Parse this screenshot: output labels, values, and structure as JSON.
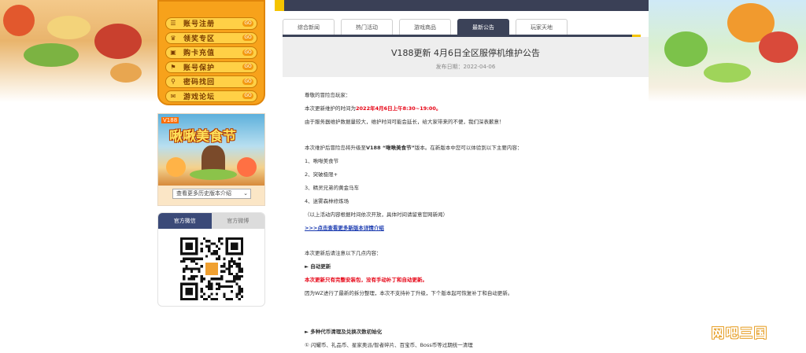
{
  "sidebar": {
    "menu": [
      {
        "label": "账号注册",
        "icon": "list-icon"
      },
      {
        "label": "领奖专区",
        "icon": "trophy-icon"
      },
      {
        "label": "购卡充值",
        "icon": "cart-icon"
      },
      {
        "label": "账号保护",
        "icon": "flag-icon"
      },
      {
        "label": "密码找回",
        "icon": "search-icon"
      },
      {
        "label": "游戏论坛",
        "icon": "chat-icon"
      }
    ],
    "menu_arrow": "GO",
    "promo": {
      "badge": "V188",
      "title": "啾啾美食节",
      "select_value": "查看更多历史版本介绍"
    },
    "qr": {
      "tabs": [
        {
          "label": "官方微信",
          "active": true
        },
        {
          "label": "官方微博",
          "active": false
        }
      ]
    }
  },
  "main": {
    "tabs": [
      {
        "label": "综合新闻",
        "active": false
      },
      {
        "label": "热门活动",
        "active": false
      },
      {
        "label": "游戏商品",
        "active": false
      },
      {
        "label": "最新公告",
        "active": true
      },
      {
        "label": "玩家天地",
        "active": false
      }
    ],
    "article": {
      "title": "V188更新 4月6日全区服停机维护公告",
      "date": "发布日期：2022-04-06",
      "greeting": "尊敬的冒险岛玩家：",
      "maint_prefix": "本次更新维护的时间为",
      "maint_time": "2022年4月6日上午8:30~19:00。",
      "apology": "由于服务器维护数据量较大，维护时间可能会延长，给大家带来的不便，我们深表歉意！",
      "upgrade_prefix": "本次维护后冒险岛将升级至",
      "upgrade_version": "V188 “啾啾美食节”",
      "upgrade_suffix": "版本。在新版本中您可以体验到以下主要内容：",
      "features": [
        "1、啾啾美食节",
        "2、突破极限+",
        "3、精灵兄弟的黄金马车",
        "4、迷雾森林修炼场"
      ],
      "features_note": "（以上活动内容根据时间依次开放，具体时间请留意官网新闻）",
      "more_link": ">>>点击查看更多新版本详情介绍",
      "notice_intro": "本次更新后请注意以下几点内容：",
      "section1_title": "► 自动更新",
      "section1_red": "本次更新只有完整安装包，没有手动补丁和自动更新。",
      "section1_text": "因为WZ进行了最新的拆分整理，本次不支持补丁升级，下个版本起可恢复补丁和自动更新。",
      "section2_title": "► 多种代币清理及兑换次数初始化",
      "section2_text": "① 闪耀币、礼品币、星家奥派/智者碎片、百宝币、Boss币等过期统一清理"
    }
  },
  "watermark": "网吧三国",
  "colors": {
    "accent": "#f5c400",
    "nav_dark": "#3b4258",
    "menu_orange": "#f7a21b",
    "red_text": "#e60012",
    "link_blue": "#1b3bb0"
  }
}
